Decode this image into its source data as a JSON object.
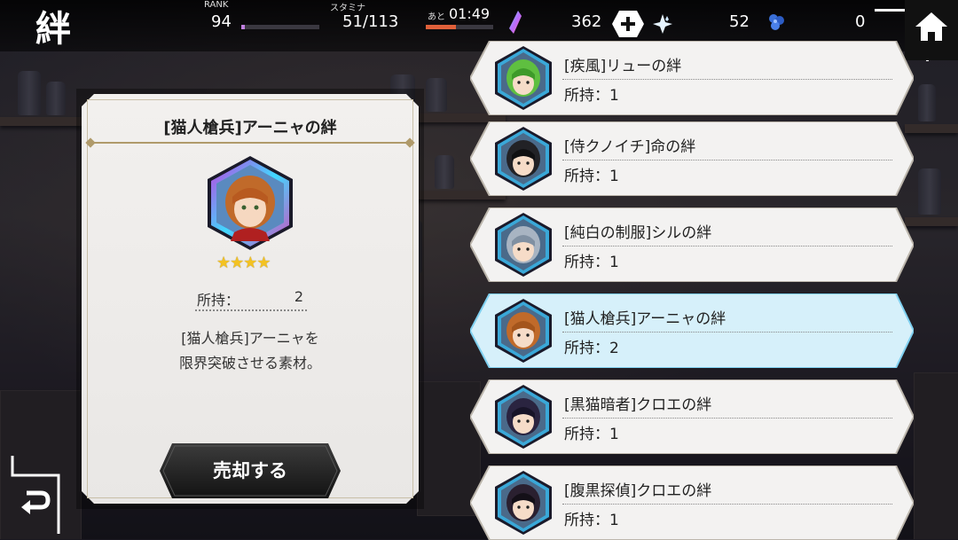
{
  "colors": {
    "accent_gold": "#b09a6a",
    "star": "#f3c222",
    "rank_bar": "#c080e0",
    "stamina_bar": "#e0603a",
    "selected_item": "#d6f0fa"
  },
  "header": {
    "kanji": "絆",
    "rank_label": "RANK",
    "rank_value": "94",
    "rank_progress": 0.05,
    "stamina_label": "スタミナ",
    "stamina_value": "51/113",
    "recover_label": "あと",
    "recover_time": "01:49",
    "stamina_progress": 0.45,
    "gem_count": "362",
    "crystal_count": "52",
    "flower_count": "0",
    "icons": [
      "gem-icon",
      "plus-icon",
      "crystal-icon",
      "blue-flower-icon",
      "home-icon"
    ]
  },
  "detail": {
    "title": "[猫人槍兵]アーニャの絆",
    "stars": "★★★★",
    "star_count": 4,
    "owned_label": "所持：",
    "owned_value": "2",
    "description_line1": "[猫人槍兵]アーニャを",
    "description_line2": "限界突破させる素材。",
    "sell_button": "売却する"
  },
  "list": [
    {
      "name": "[疾風]リューの絆",
      "owned": "所持：1",
      "portrait": "green-hair",
      "selected": false
    },
    {
      "name": "[侍クノイチ]命の絆",
      "owned": "所持：1",
      "portrait": "black-hair",
      "selected": false
    },
    {
      "name": "[純白の制服]シルの絆",
      "owned": "所持：1",
      "portrait": "silver-hair",
      "selected": false
    },
    {
      "name": "[猫人槍兵]アーニャの絆",
      "owned": "所持：2",
      "portrait": "orange-hair",
      "selected": true
    },
    {
      "name": "[黒猫暗者]クロエの絆",
      "owned": "所持：1",
      "portrait": "dark-hair",
      "selected": false
    },
    {
      "name": "[腹黒探偵]クロエの絆",
      "owned": "所持：1",
      "portrait": "dark-hat",
      "selected": false
    }
  ]
}
